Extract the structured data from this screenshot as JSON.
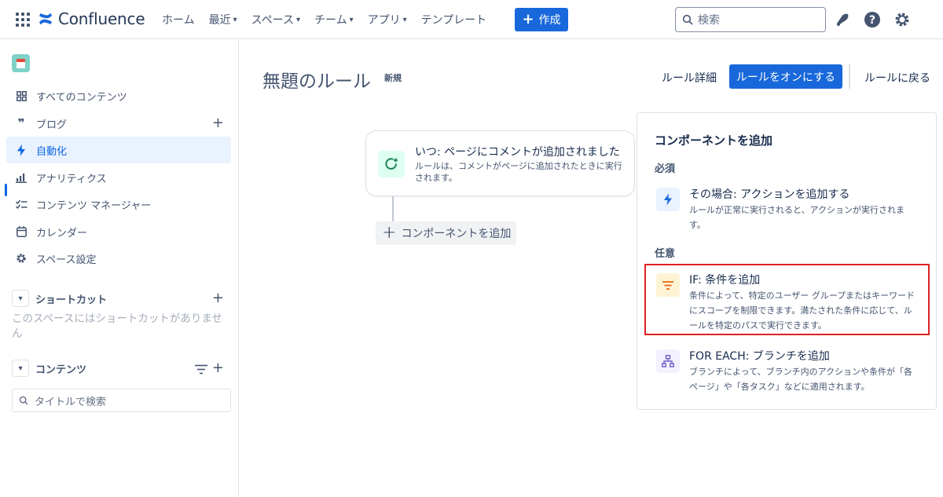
{
  "nav": {
    "product": "Confluence",
    "items": [
      {
        "label": "ホーム",
        "has_dropdown": false
      },
      {
        "label": "最近",
        "has_dropdown": true
      },
      {
        "label": "スペース",
        "has_dropdown": true
      },
      {
        "label": "チーム",
        "has_dropdown": true
      },
      {
        "label": "アプリ",
        "has_dropdown": true
      },
      {
        "label": "テンプレート",
        "has_dropdown": false
      }
    ],
    "create_label": "作成",
    "search_placeholder": "検索"
  },
  "sidebar": {
    "items": [
      {
        "label": "すべてのコンテンツ",
        "icon": "overview-icon"
      },
      {
        "label": "ブログ",
        "icon": "quote-icon"
      },
      {
        "label": "自動化",
        "icon": "lightning-icon"
      },
      {
        "label": "アナリティクス",
        "icon": "bar-chart-icon"
      },
      {
        "label": "コンテンツ マネージャー",
        "icon": "checklist-icon"
      },
      {
        "label": "カレンダー",
        "icon": "calendar-icon"
      },
      {
        "label": "スペース設定",
        "icon": "gear-icon"
      }
    ],
    "shortcuts_label": "ショートカット",
    "shortcuts_empty": "このスペースにはショートカットがありません",
    "content_label": "コンテンツ",
    "title_search_placeholder": "タイトルで検索"
  },
  "main": {
    "title": "無題のルール",
    "badge": "新規",
    "rule_detail": "ルール詳細",
    "enable_button": "ルールをオンにする",
    "back_link": "ルールに戻る",
    "trigger": {
      "title": "いつ: ページにコメントが追加されました",
      "description": "ルールは、コメントがページに追加されたときに実行されます。"
    },
    "add_component": "コンポーネントを追加"
  },
  "panel": {
    "title": "コンポーネントを追加",
    "required_label": "必須",
    "optional_label": "任意",
    "options": [
      {
        "title": "その場合: アクションを追加する",
        "description": "ルールが正常に実行されると、アクションが実行されます。"
      },
      {
        "title": "IF: 条件を追加",
        "description": "条件によって、特定のユーザー グループまたはキーワードにスコープを制限できます。満たされた条件に応じて、ルールを特定のパスで実行できます。"
      },
      {
        "title": "FOR EACH: ブランチを追加",
        "description": "ブランチによって、ブランチ内のアクションや条件が「各ページ」や「各タスク」などに適用されます。"
      }
    ]
  },
  "colors": {
    "brand_blue": "#1868db",
    "highlight_red": "#e02020",
    "action_icon_bg": "#e9f2ff",
    "condition_icon_bg": "#fff3d6",
    "branch_icon_bg": "#f3f0ff"
  }
}
